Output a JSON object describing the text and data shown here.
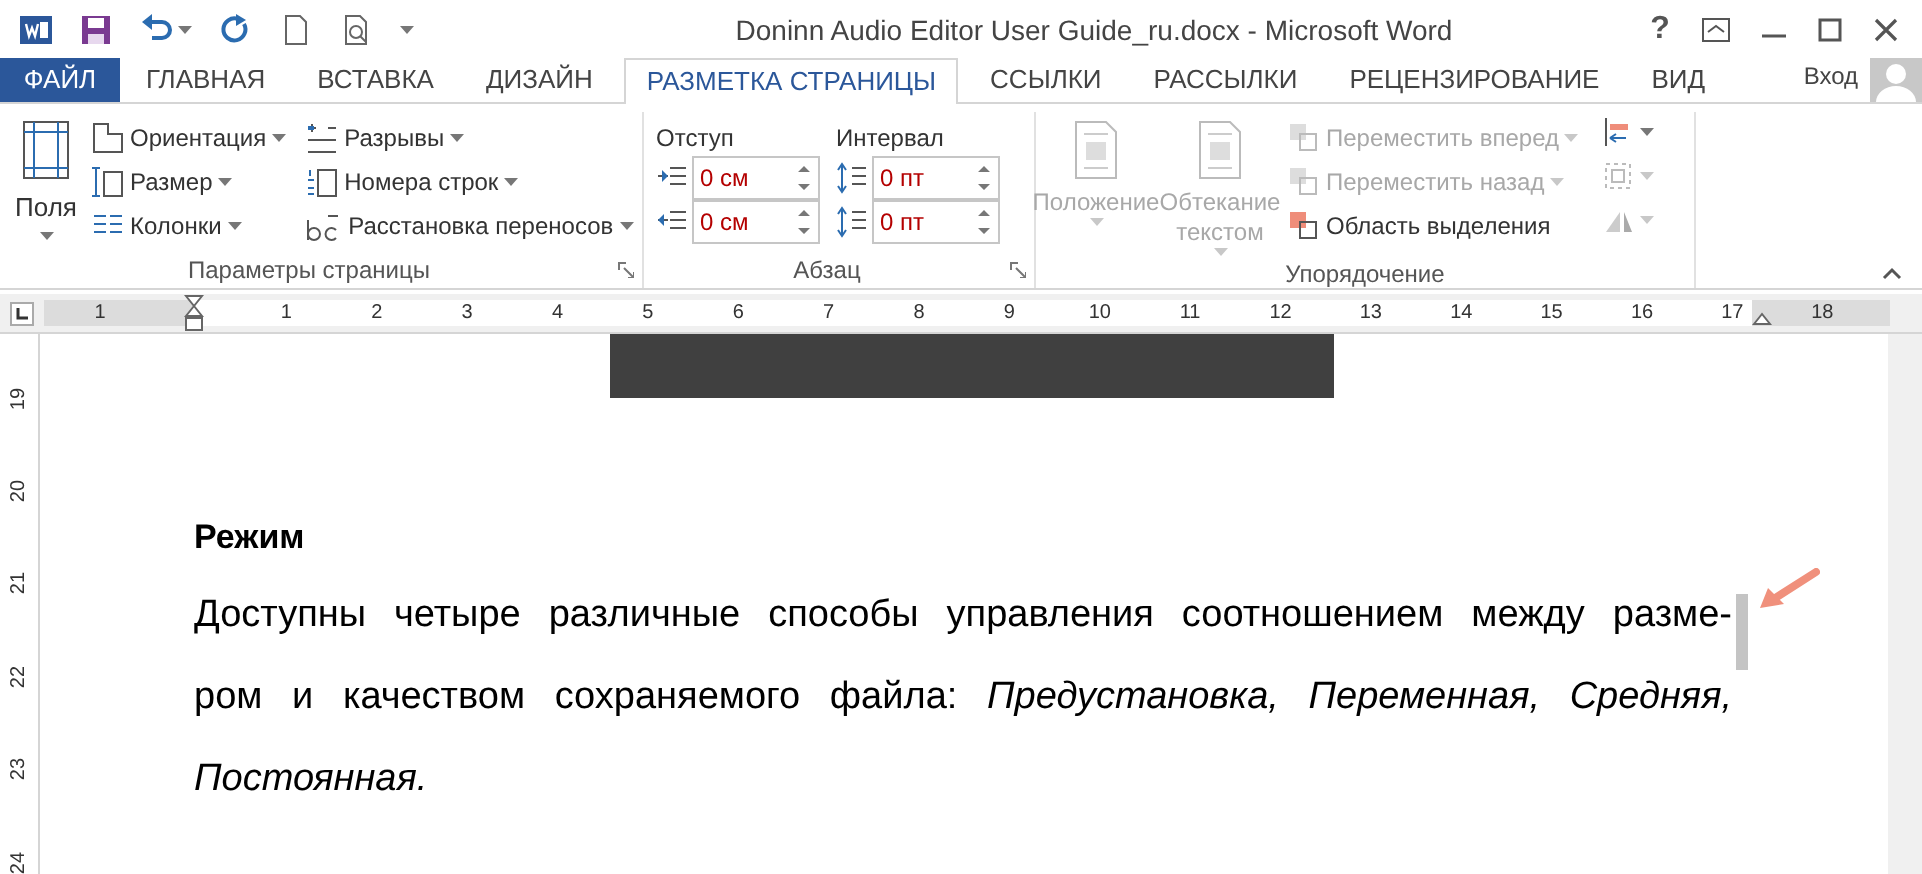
{
  "title_bar": {
    "title": "Doninn Audio Editor User Guide_ru.docx - Microsoft Word",
    "help": "?"
  },
  "tabs": [
    {
      "label": "ФАЙЛ",
      "kind": "file",
      "selected": false
    },
    {
      "label": "ГЛАВНАЯ",
      "kind": "tab",
      "selected": false
    },
    {
      "label": "ВСТАВКА",
      "kind": "tab",
      "selected": false
    },
    {
      "label": "ДИЗАЙН",
      "kind": "tab",
      "selected": false
    },
    {
      "label": "РАЗМЕТКА СТРАНИЦЫ",
      "kind": "tab",
      "selected": true
    },
    {
      "label": "ССЫЛКИ",
      "kind": "tab",
      "selected": false
    },
    {
      "label": "РАССЫЛКИ",
      "kind": "tab",
      "selected": false
    },
    {
      "label": "РЕЦЕНЗИРОВАНИЕ",
      "kind": "tab",
      "selected": false
    },
    {
      "label": "ВИД",
      "kind": "tab",
      "selected": false
    }
  ],
  "account": {
    "label": "Вход"
  },
  "page_setup": {
    "title": "Параметры страницы",
    "big_button": "Поля",
    "commands": [
      {
        "label": "Ориентация",
        "kind": "orientation"
      },
      {
        "label": "Размер",
        "kind": "size"
      },
      {
        "label": "Колонки",
        "kind": "columns"
      },
      {
        "label": "Разрывы",
        "kind": "breaks"
      },
      {
        "label": "Номера строк",
        "kind": "line-numbers"
      },
      {
        "label": "Расстановка переносов",
        "kind": "hyphenation"
      }
    ]
  },
  "paragraph": {
    "title": "Абзац",
    "indent_label": "Отступ",
    "spacing_label": "Интервал",
    "indent": [
      "0 см",
      "0 см"
    ],
    "spacing": [
      "0 пт",
      "0 пт"
    ]
  },
  "arrange": {
    "title": "Упорядочение",
    "big_buttons": [
      {
        "label": "Положение",
        "disabled": true
      },
      {
        "label": "Обтекание текстом",
        "disabled": true
      }
    ],
    "commands": [
      {
        "label": "Переместить вперед",
        "disabled": true
      },
      {
        "label": "Переместить назад",
        "disabled": true
      },
      {
        "label": "Область выделения",
        "disabled": false
      }
    ]
  },
  "ruler": {
    "horizontal": [
      "1",
      "1",
      "2",
      "3",
      "4",
      "5",
      "6",
      "7",
      "8",
      "9",
      "10",
      "11",
      "12",
      "13",
      "14",
      "15",
      "16",
      "17",
      "18"
    ],
    "vertical": [
      "19",
      "20",
      "21",
      "22",
      "23",
      "24"
    ]
  },
  "document": {
    "heading": "Режим",
    "lines": [
      "Доступны четыре различные способы управления соотношением между разме-",
      "ром и качеством сохраняемого файла: *Предустановка, Переменная, Средняя,*",
      "*Постоянная.*"
    ]
  }
}
